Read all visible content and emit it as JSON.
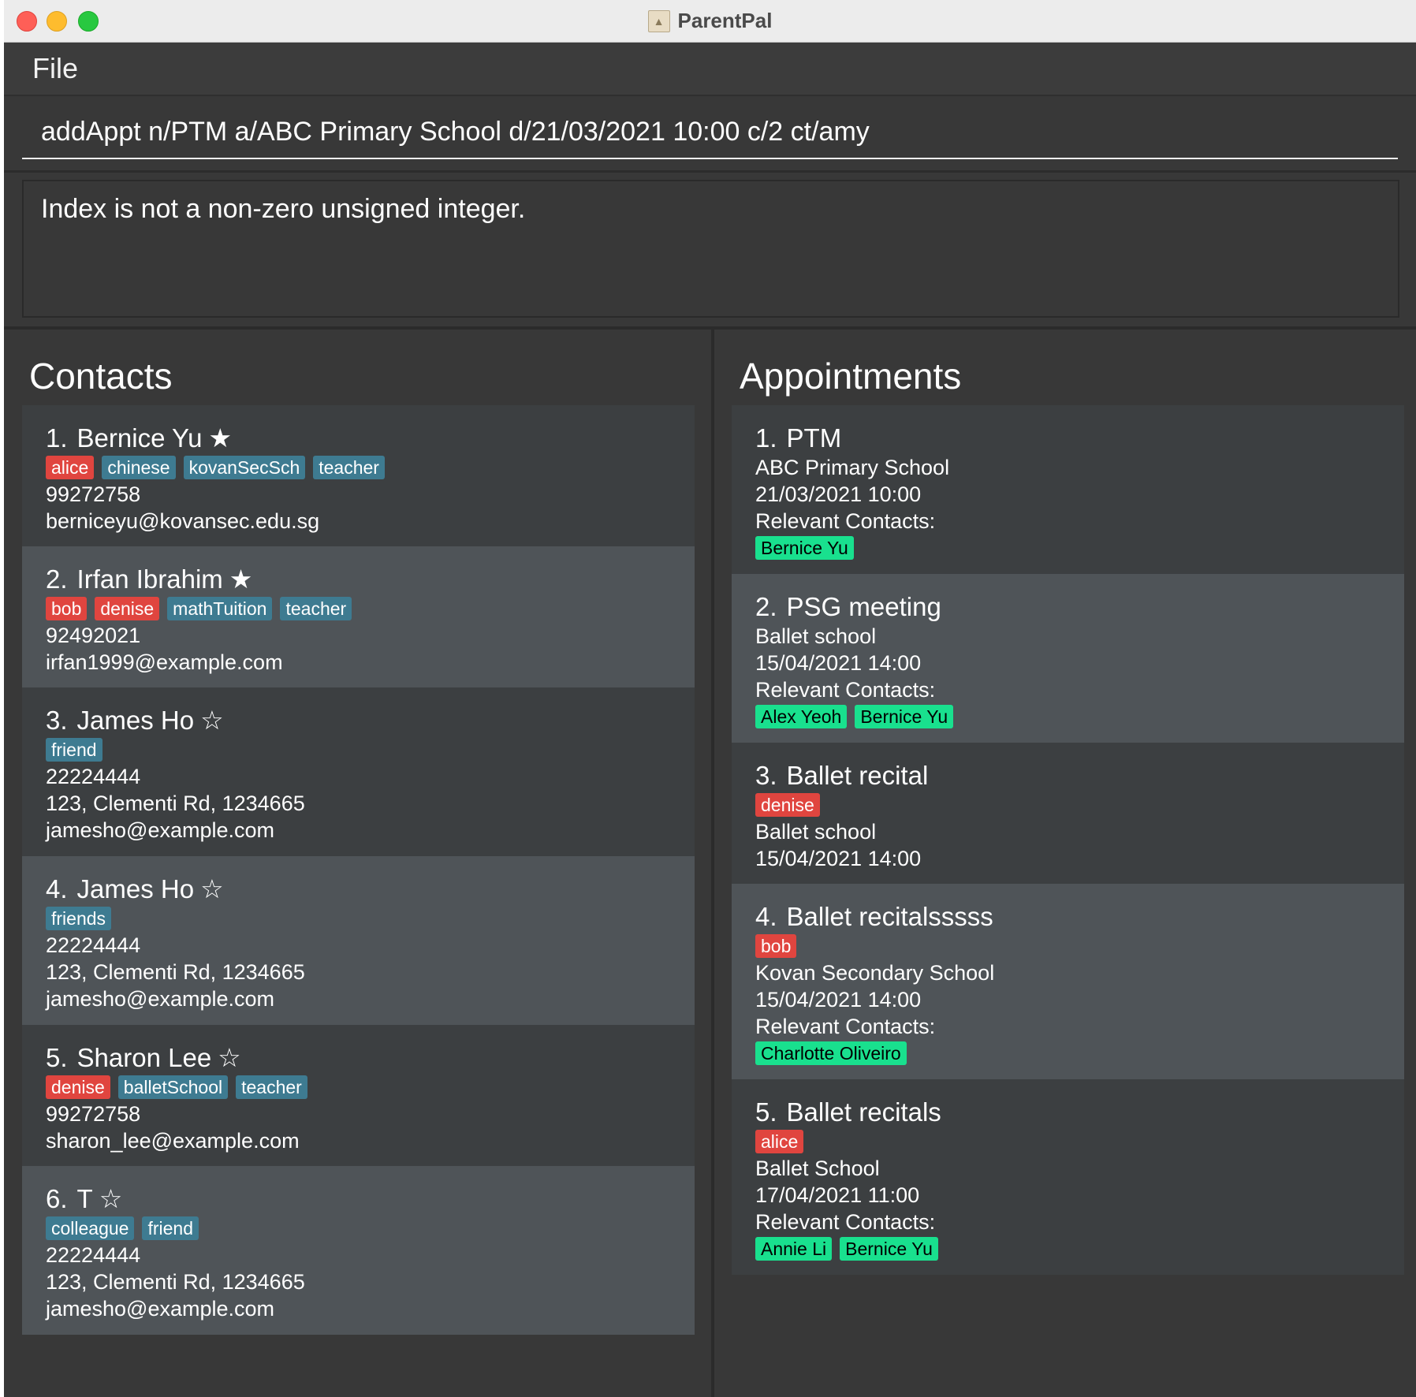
{
  "window": {
    "title": "ParentPal"
  },
  "menu": {
    "file": "File"
  },
  "command": {
    "value": "addAppt n/PTM a/ABC Primary School d/21/03/2021 10:00 c/2 ct/amy"
  },
  "result": {
    "text": "Index is not a non-zero unsigned integer."
  },
  "contacts": {
    "title": "Contacts",
    "items": [
      {
        "index": "1.",
        "name": "Bernice Yu",
        "star": "★",
        "red_tags": [
          "alice"
        ],
        "blue_tags": [
          "chinese",
          "kovanSecSch",
          "teacher"
        ],
        "lines": [
          "99272758",
          "berniceyu@kovansec.edu.sg"
        ]
      },
      {
        "index": "2.",
        "name": "Irfan Ibrahim",
        "star": "★",
        "red_tags": [
          "bob",
          "denise"
        ],
        "blue_tags": [
          "mathTuition",
          "teacher"
        ],
        "lines": [
          "92492021",
          "irfan1999@example.com"
        ]
      },
      {
        "index": "3.",
        "name": "James Ho",
        "star": "☆",
        "red_tags": [],
        "blue_tags": [
          "friend"
        ],
        "lines": [
          "22224444",
          "123, Clementi Rd, 1234665",
          "jamesho@example.com"
        ]
      },
      {
        "index": "4.",
        "name": "James Ho",
        "star": "☆",
        "red_tags": [],
        "blue_tags": [
          "friends"
        ],
        "lines": [
          "22224444",
          "123, Clementi Rd, 1234665",
          "jamesho@example.com"
        ]
      },
      {
        "index": "5.",
        "name": "Sharon Lee",
        "star": "☆",
        "red_tags": [
          "denise"
        ],
        "blue_tags": [
          "balletSchool",
          "teacher"
        ],
        "lines": [
          "99272758",
          "sharon_lee@example.com"
        ]
      },
      {
        "index": "6.",
        "name": "T",
        "star": "☆",
        "red_tags": [],
        "blue_tags": [
          "colleague",
          "friend"
        ],
        "lines": [
          "22224444",
          "123, Clementi Rd, 1234665",
          "jamesho@example.com"
        ]
      }
    ]
  },
  "appointments": {
    "title": "Appointments",
    "items": [
      {
        "index": "1.",
        "name": "PTM",
        "tags": [],
        "lines": [
          "ABC Primary School",
          "21/03/2021 10:00",
          "Relevant Contacts:"
        ],
        "contacts": [
          "Bernice Yu"
        ]
      },
      {
        "index": "2.",
        "name": "PSG meeting",
        "tags": [],
        "lines": [
          "Ballet school",
          "15/04/2021 14:00",
          "Relevant Contacts:"
        ],
        "contacts": [
          "Alex Yeoh",
          "Bernice Yu"
        ]
      },
      {
        "index": "3.",
        "name": "Ballet recital",
        "tags": [
          "denise"
        ],
        "lines": [
          "Ballet school",
          "15/04/2021 14:00"
        ],
        "contacts": []
      },
      {
        "index": "4.",
        "name": "Ballet recitalsssss",
        "tags": [
          "bob"
        ],
        "lines": [
          "Kovan Secondary School",
          "15/04/2021 14:00",
          "Relevant Contacts:"
        ],
        "contacts": [
          "Charlotte Oliveiro"
        ]
      },
      {
        "index": "5.",
        "name": "Ballet recitals",
        "tags": [
          "alice"
        ],
        "lines": [
          "Ballet School",
          "17/04/2021 11:00",
          "Relevant Contacts:"
        ],
        "contacts": [
          "Annie Li",
          "Bernice Yu"
        ]
      }
    ]
  },
  "colors": {
    "background": "#383838",
    "card_dark": "#3c3f41",
    "card_light": "#4f5458",
    "tag_red": "#e0453f",
    "tag_blue": "#3e7b91",
    "tag_green": "#19e08e"
  }
}
